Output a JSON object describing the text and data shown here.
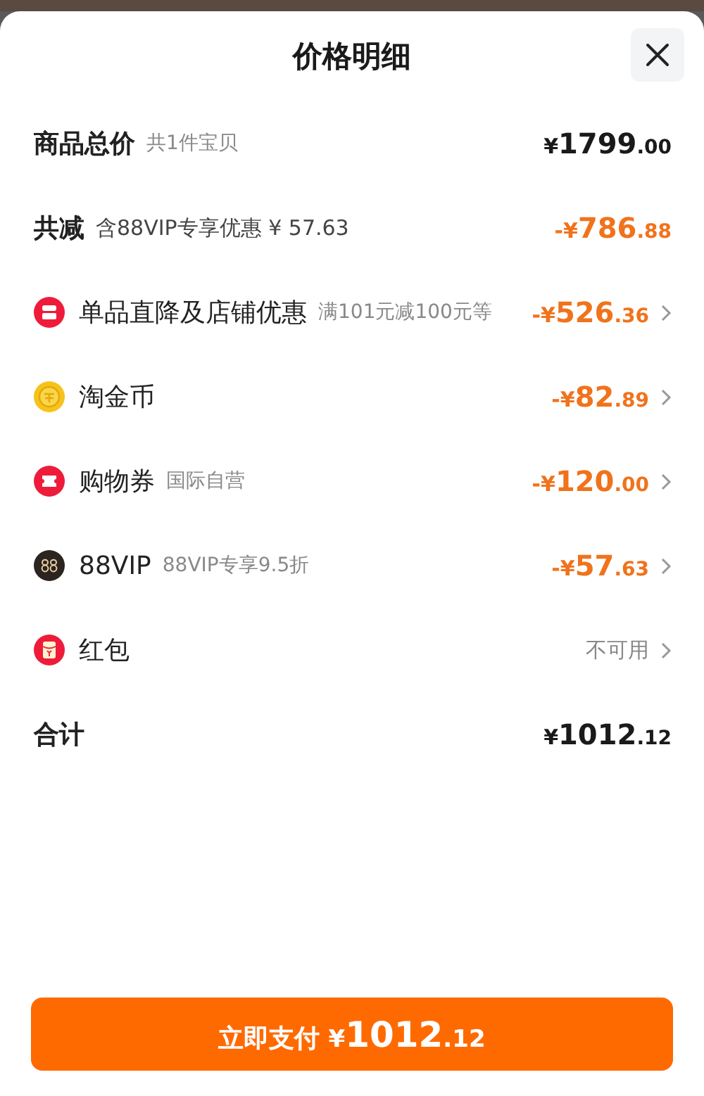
{
  "title": "价格明细",
  "rows": [
    {
      "kind": "plain",
      "label": "商品总价",
      "bold": true,
      "note": "共1件宝贝",
      "value": {
        "kind": "amount",
        "discount": false,
        "sign": "¥",
        "int": "1799",
        "dec": ".00"
      },
      "chevron": false
    },
    {
      "kind": "plain",
      "label": "共减",
      "bold": true,
      "note": "含88VIP专享优惠 ¥ 57.63",
      "value": {
        "kind": "amount",
        "discount": true,
        "sign": "-¥",
        "int": "786",
        "dec": ".88"
      },
      "chevron": false
    },
    {
      "kind": "shop",
      "label": "单品直降及店铺优惠",
      "bold": false,
      "note": "满101元减100元等",
      "value": {
        "kind": "amount",
        "discount": true,
        "sign": "-¥",
        "int": "526",
        "dec": ".36"
      },
      "chevron": true
    },
    {
      "kind": "coin",
      "label": "淘金币",
      "bold": false,
      "value": {
        "kind": "amount",
        "discount": true,
        "sign": "-¥",
        "int": "82",
        "dec": ".89"
      },
      "chevron": true
    },
    {
      "kind": "ticket",
      "label": "购物券",
      "bold": false,
      "note": "国际自营",
      "value": {
        "kind": "amount",
        "discount": true,
        "sign": "-¥",
        "int": "120",
        "dec": ".00"
      },
      "chevron": true
    },
    {
      "kind": "vip",
      "label": "88VIP",
      "bold": false,
      "note": "88VIP专享9.5折",
      "value": {
        "kind": "amount",
        "discount": true,
        "sign": "-¥",
        "int": "57",
        "dec": ".63"
      },
      "chevron": true
    },
    {
      "kind": "redpacket",
      "label": "红包",
      "bold": false,
      "value": {
        "kind": "text",
        "text": "不可用"
      },
      "chevron": true
    },
    {
      "kind": "plain",
      "label": "合计",
      "bold": true,
      "value": {
        "kind": "amount",
        "discount": false,
        "sign": "¥",
        "int": "1012",
        "dec": ".12"
      },
      "chevron": false
    }
  ],
  "pay_button": {
    "label": "立即支付",
    "sign": "¥",
    "int": "1012",
    "dec": ".12"
  }
}
